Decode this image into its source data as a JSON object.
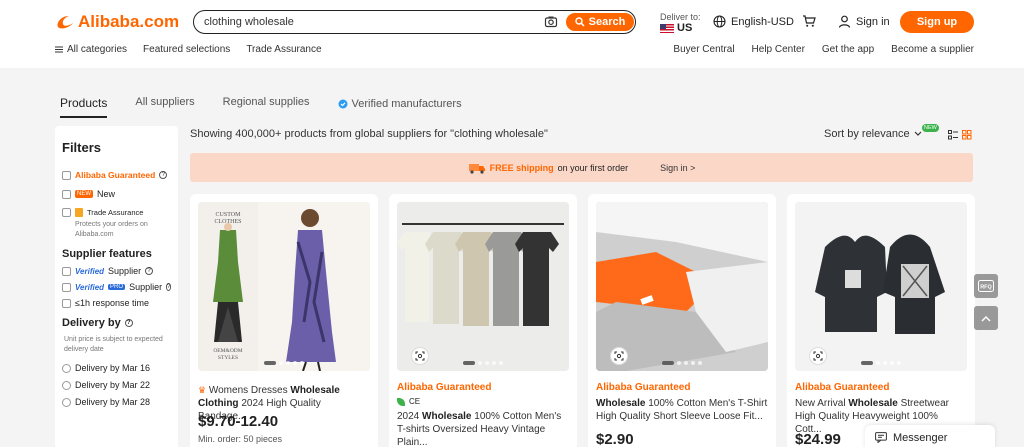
{
  "brand": {
    "name": "Alibaba.com",
    "accent": "#ff6600"
  },
  "search": {
    "value": "clothing wholesale",
    "button_label": "Search"
  },
  "deliver": {
    "label": "Deliver to:",
    "country": "US"
  },
  "language": "English-USD",
  "signin_label": "Sign in",
  "signup_label": "Sign up",
  "subnav_left": {
    "all_categories": "All categories",
    "featured": "Featured selections",
    "trade_assurance": "Trade Assurance"
  },
  "subnav_right": [
    "Buyer Central",
    "Help Center",
    "Get the app",
    "Become a supplier"
  ],
  "tabs": {
    "products": "Products",
    "suppliers": "All suppliers",
    "regional": "Regional supplies",
    "verified": "Verified manufacturers"
  },
  "filters": {
    "title": "Filters",
    "ag_label": "Alibaba Guaranteed",
    "new_badge": "NEW",
    "new_label": "New",
    "trade_assurance_label": "Trade Assurance",
    "trade_assurance_note": "Protects your orders on Alibaba.com",
    "supplier_features_title": "Supplier features",
    "verified_word": "Verified",
    "supplier_label": "Supplier",
    "pro_badge": "PRO",
    "pro_supplier_label": "Supplier",
    "response_label": "≤1h response time",
    "delivery_title": "Delivery by",
    "delivery_note": "Unit price is subject to expected delivery date",
    "delivery_options": [
      "Delivery by Mar 16",
      "Delivery by Mar 22",
      "Delivery by Mar 28"
    ]
  },
  "results": {
    "showing_text": "Showing 400,000+ products from global suppliers for \"clothing wholesale\"",
    "sort_label": "Sort by relevance",
    "sort_new_badge": "NEW"
  },
  "promo": {
    "free_shipping": "FREE shipping",
    "rest": "on your first order",
    "signin": "Sign in >"
  },
  "products": [
    {
      "title_pre": "Womens Dresses ",
      "title_bold": "Wholesale",
      "title_line2_bold": "Clothing",
      "title_post": " 2024 High Quality Bandage...",
      "price": "$9.70-12.40",
      "moq": "Min. order: 50 pieces",
      "img_text_1": "CUSTOM",
      "img_text_2": "CLOTHES",
      "img_text_3": "OEM&ODM",
      "img_text_4": "STYLES"
    },
    {
      "guaranteed": "Alibaba Guaranteed",
      "cert": "CE",
      "title_pre": "2024 ",
      "title_bold": "Wholesale",
      "title_post": " 100% Cotton Men's T-shirts Oversized Heavy Vintage Plain..."
    },
    {
      "guaranteed": "Alibaba Guaranteed",
      "title_bold": "Wholesale",
      "title_post": " 100% Cotton Men's T-Shirt High Quality Short Sleeve Loose Fit...",
      "price": "$2.90"
    },
    {
      "guaranteed": "Alibaba Guaranteed",
      "title_pre": "New Arrival ",
      "title_bold": "Wholesale",
      "title_post": " Streetwear High Quality Heavyweight 100% Cott...",
      "price": "$24.99"
    }
  ],
  "float": {
    "rfq": "RFQ"
  },
  "messenger_label": "Messenger"
}
